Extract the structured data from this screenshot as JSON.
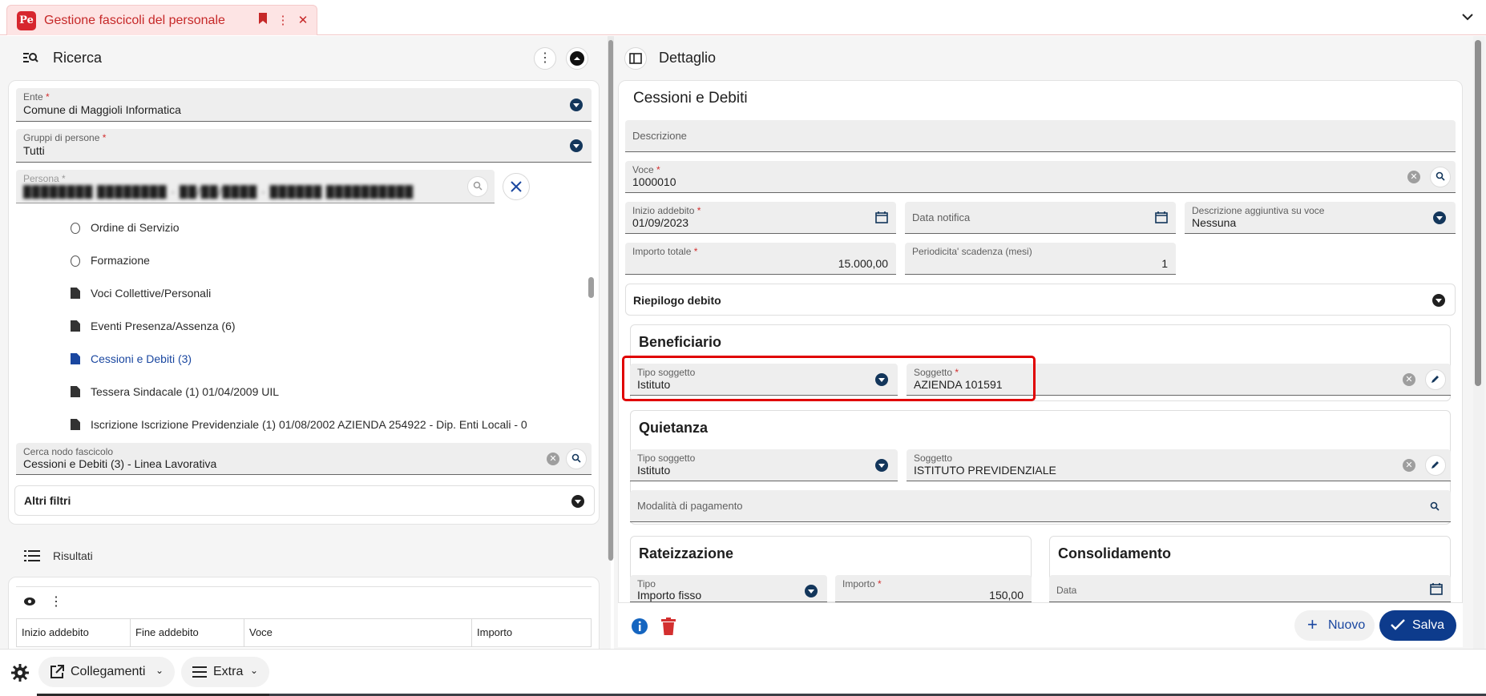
{
  "app": {
    "title": "Gestione fascicoli del personale",
    "logo_text": "Pe"
  },
  "left": {
    "title": "Ricerca",
    "fields": {
      "ente": {
        "label": "Ente",
        "value": "Comune di Maggioli Informatica"
      },
      "gruppi": {
        "label": "Gruppi di persone",
        "value": "Tutti"
      },
      "persona": {
        "label": "Persona",
        "value": "████████ ████████ · ██/██/████ · ██████ ██████████"
      }
    },
    "tree": [
      {
        "label": "Ordine di Servizio",
        "icon": "radio-icon"
      },
      {
        "label": "Formazione",
        "icon": "radio-icon"
      },
      {
        "label": "Voci Collettive/Personali",
        "icon": "document-icon"
      },
      {
        "label": "Eventi Presenza/Assenza (6)",
        "icon": "document-icon"
      },
      {
        "label": "Cessioni e Debiti (3)",
        "icon": "document-icon",
        "active": true
      },
      {
        "label": "Tessera Sindacale (1) 01/04/2009 UIL",
        "icon": "document-icon"
      },
      {
        "label": "Iscrizione Iscrizione Previdenziale (1) 01/08/2002 AZIENDA 254922 - Dip. Enti Locali - 0",
        "icon": "document-icon"
      }
    ],
    "cerca_nodo": {
      "label": "Cerca nodo fascicolo",
      "value": "Cessioni e Debiti (3) - Linea Lavorativa"
    },
    "altri_filtri": "Altri filtri",
    "risultati": "Risultati",
    "table_columns": [
      "Inizio addebito",
      "Fine addebito",
      "Voce",
      "Importo"
    ]
  },
  "right": {
    "title": "Dettaglio",
    "section_title": "Cessioni e Debiti",
    "descrizione": {
      "label": "Descrizione",
      "value": ""
    },
    "voce": {
      "label": "Voce",
      "value": "1000010"
    },
    "inizio_addebito": {
      "label": "Inizio addebito",
      "value": "01/09/2023"
    },
    "data_notifica": {
      "label": "Data notifica",
      "value": ""
    },
    "descrizione_aggiuntiva": {
      "label": "Descrizione aggiuntiva su voce",
      "value": "Nessuna"
    },
    "importo_totale": {
      "label": "Importo totale",
      "value": "15.000,00"
    },
    "periodicita": {
      "label": "Periodicita' scadenza (mesi)",
      "value": "1"
    },
    "riepilogo": "Riepilogo debito",
    "beneficiario": {
      "title": "Beneficiario",
      "tipo_soggetto": {
        "label": "Tipo soggetto",
        "value": "Istituto"
      },
      "soggetto": {
        "label": "Soggetto",
        "value": "AZIENDA 101591"
      }
    },
    "quietanza": {
      "title": "Quietanza",
      "tipo_soggetto": {
        "label": "Tipo soggetto",
        "value": "Istituto"
      },
      "soggetto": {
        "label": "Soggetto",
        "value": "ISTITUTO PREVIDENZIALE"
      },
      "modalita": {
        "label": "Modalità di pagamento",
        "value": ""
      }
    },
    "rateizzazione": {
      "title": "Rateizzazione",
      "tipo": {
        "label": "Tipo",
        "value": "Importo fisso"
      },
      "importo": {
        "label": "Importo",
        "value": "150,00"
      }
    },
    "consolidamento": {
      "title": "Consolidamento",
      "data": {
        "label": "Data",
        "value": ""
      }
    },
    "buttons": {
      "nuovo": "Nuovo",
      "salva": "Salva"
    }
  },
  "bottom": {
    "collegamenti": "Collegamenti",
    "extra": "Extra"
  },
  "colors": {
    "brand": "#d7262e",
    "accent": "#0d3b8c",
    "highlight": "#e00000"
  }
}
